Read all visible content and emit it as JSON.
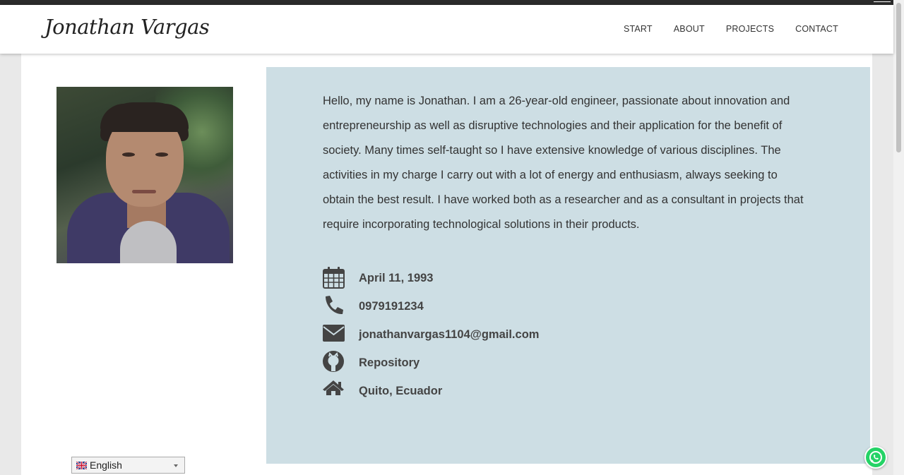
{
  "header": {
    "brand": "Jonathan Vargas",
    "nav": [
      "START",
      "ABOUT",
      "PROJECTS",
      "CONTACT"
    ]
  },
  "about": {
    "bio": "Hello, my name is Jonathan. I am a 26-year-old engineer, passionate about innovation and entrepreneurship as well as disruptive technologies and their application for the benefit of society. Many times self-taught so I have extensive knowledge of various disciplines. The activities in my charge I carry out with a lot of energy and enthusiasm, always seeking to obtain the best result. I have worked both as a researcher and as a consultant in projects that require incorporating technological solutions in their products.",
    "info": [
      {
        "icon": "calendar-icon",
        "text": "April 11, 1993"
      },
      {
        "icon": "phone-icon",
        "text": "0979191234"
      },
      {
        "icon": "envelope-icon",
        "text": "jonathanvargas1104@gmail.com"
      },
      {
        "icon": "github-icon",
        "text": "Repository"
      },
      {
        "icon": "home-icon",
        "text": "Quito, Ecuador"
      }
    ]
  },
  "language": {
    "selected": "English",
    "icon": "uk-flag-icon"
  },
  "floating": {
    "icon": "whatsapp-icon"
  },
  "colors": {
    "panel": "#cddee4",
    "topbar": "#2b2b2b",
    "whatsapp": "#25d366"
  }
}
